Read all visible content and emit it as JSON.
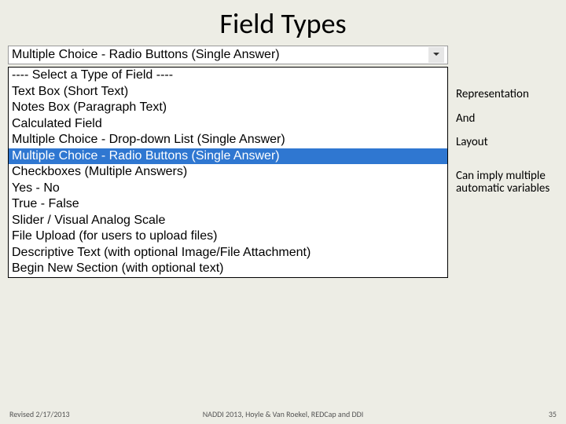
{
  "title": "Field Types",
  "combo": {
    "selected_label": "Multiple Choice - Radio Buttons (Single Answer)"
  },
  "options": [
    {
      "label": "---- Select a Type of Field ----",
      "selected": false
    },
    {
      "label": "Text Box (Short Text)",
      "selected": false
    },
    {
      "label": "Notes Box (Paragraph Text)",
      "selected": false
    },
    {
      "label": "Calculated Field",
      "selected": false
    },
    {
      "label": "Multiple Choice - Drop-down List (Single Answer)",
      "selected": false
    },
    {
      "label": "Multiple Choice - Radio Buttons (Single Answer)",
      "selected": true
    },
    {
      "label": "Checkboxes (Multiple Answers)",
      "selected": false
    },
    {
      "label": "Yes - No",
      "selected": false
    },
    {
      "label": "True - False",
      "selected": false
    },
    {
      "label": "Slider / Visual Analog Scale",
      "selected": false
    },
    {
      "label": "File Upload (for users to upload files)",
      "selected": false
    },
    {
      "label": "Descriptive Text (with optional Image/File Attachment)",
      "selected": false
    },
    {
      "label": "Begin New Section (with optional text)",
      "selected": false
    }
  ],
  "notes": {
    "n1": "Representation",
    "n2": "And",
    "n3": "Layout",
    "n4": "Can imply multiple automatic variables"
  },
  "footer": {
    "left": "Revised 2/17/2013",
    "center": "NADDI 2013, Hoyle & Van Roekel, REDCap and DDI",
    "right": "35"
  }
}
